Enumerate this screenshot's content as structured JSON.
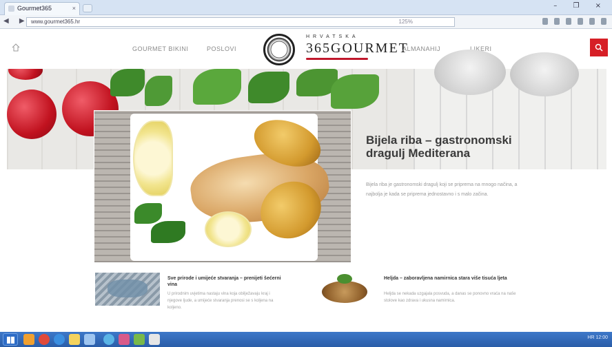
{
  "browser": {
    "tab_title": "Gourmet365",
    "tab_close": "×",
    "url": "www.gourmet365.hr",
    "zoom": "125%",
    "window_controls": "– ❐ ×",
    "nav_buttons": "◀ ▶"
  },
  "site": {
    "nav": [
      "GOURMET BIKINI",
      "POSLOVI",
      "ALMANAHIJ",
      "LIKERI"
    ],
    "logo_small": "HRVATSKA",
    "logo_big": "365GOURMET"
  },
  "feature": {
    "title": "Bijela riba – gastronomski dragulj Mediterana",
    "excerpt": "Bijela riba je gastronomski dragulj koji se priprema na mnogo načina, a najbolja je kada se priprema jednostavno i s malo začina."
  },
  "cards": [
    {
      "title": "Sve prirode i umijeće stvaranja – prenijeti šećerni vina",
      "excerpt": "U prirodnim uvjetima nastaju vina koja obilježavaju kraj i njegove ljude, a umijeće stvaranja prenosi se s koljena na koljeno."
    },
    {
      "title": "Heljda – zaboravljena namirnica stara više tisuća ljeta",
      "excerpt": "Heljda se nekada uzgajala posvuda, a danas se ponovno vraća na naše stolove kao zdrava i ukusna namirnica."
    }
  ],
  "colors": {
    "accent_red": "#d61f26",
    "title_gray": "#3a3a3a",
    "taskbar_blue": "#2a5da8"
  },
  "icons": {
    "home": "home-icon",
    "search": "search-icon",
    "logo": "logo-emblem-icon"
  },
  "taskbar": {
    "tray_text": "HR  12:00"
  }
}
